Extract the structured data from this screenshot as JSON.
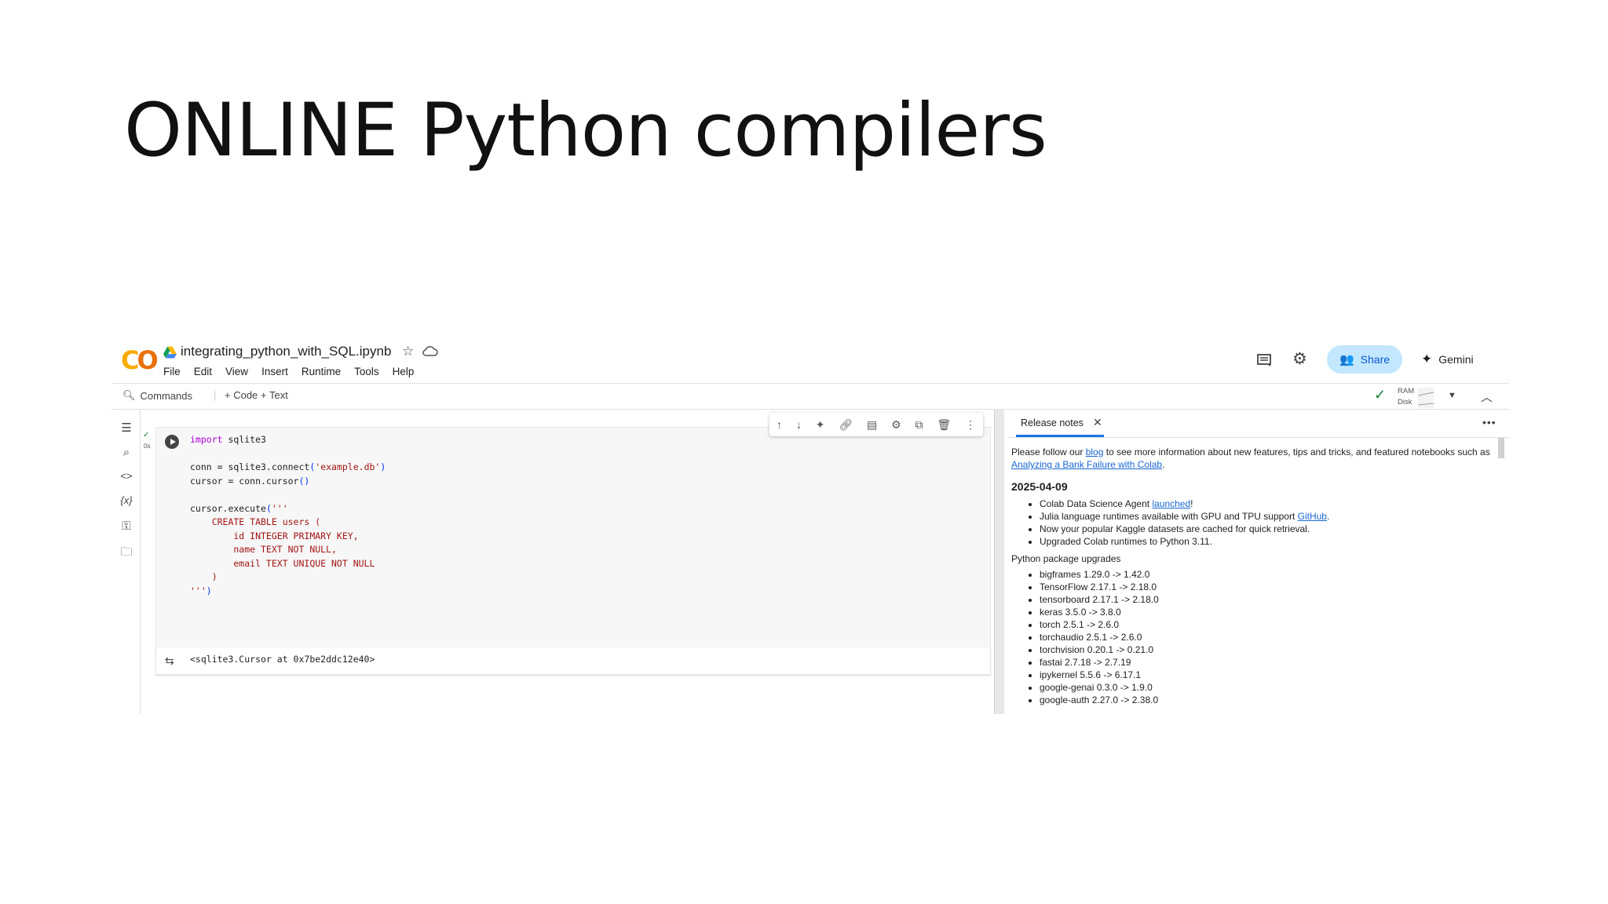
{
  "slide": {
    "title": "ONLINE Python compilers"
  },
  "header": {
    "logo_left": "C",
    "logo_right": "O",
    "notebook_title": "integrating_python_with_SQL.ipynb",
    "menu": [
      "File",
      "Edit",
      "View",
      "Insert",
      "Runtime",
      "Tools",
      "Help"
    ],
    "share_label": "Share",
    "gemini_label": "Gemini"
  },
  "toolbar": {
    "commands_label": "Commands",
    "add_code_label": "+ Code",
    "add_text_label": "+ Text",
    "ram_label": "RAM",
    "disk_label": "Disk"
  },
  "cell": {
    "exec_time": "0s",
    "code_lines": [
      "import sqlite3",
      "",
      "conn = sqlite3.connect('example.db')",
      "cursor = conn.cursor()",
      "",
      "cursor.execute('''",
      "    CREATE TABLE users (",
      "        id INTEGER PRIMARY KEY,",
      "        name TEXT NOT NULL,",
      "        email TEXT UNIQUE NOT NULL",
      "    )",
      "''')"
    ],
    "output": "<sqlite3.Cursor at 0x7be2ddc12e40>"
  },
  "release_notes": {
    "tab_label": "Release notes",
    "intro_before": "Please follow our ",
    "intro_link1": "blog",
    "intro_middle": " to see more information about new features, tips and tricks, and featured notebooks such as ",
    "intro_link2": "Analyzing a Bank Failure with Colab",
    "intro_after": ".",
    "date": "2025-04-09",
    "items": [
      {
        "before": "Colab Data Science Agent ",
        "link": "launched",
        "after": "!"
      },
      {
        "before": "Julia language runtimes available with GPU and TPU support ",
        "link": "GitHub",
        "after": "."
      },
      {
        "before": "Now your popular Kaggle datasets are cached for quick retrieval.",
        "link": "",
        "after": ""
      },
      {
        "before": "Upgraded Colab runtimes to Python 3.11.",
        "link": "",
        "after": ""
      }
    ],
    "package_heading": "Python package upgrades",
    "packages": [
      "bigframes 1.29.0 -> 1.42.0",
      "TensorFlow 2.17.1 -> 2.18.0",
      "tensorboard 2.17.1 -> 2.18.0",
      "keras 3.5.0 -> 3.8.0",
      "torch 2.5.1 -> 2.6.0",
      "torchaudio 2.5.1 -> 2.6.0",
      "torchvision 0.20.1 -> 0.21.0",
      "fastai 2.7.18 -> 2.7.19",
      "ipykernel 5.5.6 -> 6.17.1",
      "google-genai 0.3.0 -> 1.9.0",
      "google-auth 2.27.0 -> 2.38.0"
    ]
  }
}
